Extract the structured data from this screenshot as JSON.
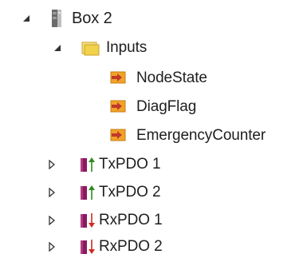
{
  "tree": {
    "box": {
      "label": "Box 2",
      "expanded": true,
      "icon": "device-icon"
    },
    "inputs": {
      "label": "Inputs",
      "expanded": true,
      "icon": "folder-icon",
      "folder_color": "#f2d14b"
    },
    "variables": [
      {
        "label": "NodeState",
        "icon": "input-variable-icon"
      },
      {
        "label": "DiagFlag",
        "icon": "input-variable-icon"
      },
      {
        "label": "EmergencyCounter",
        "icon": "input-variable-icon"
      }
    ],
    "pdos": [
      {
        "label": "TxPDO 1",
        "expanded": false,
        "icon": "tx-pdo-icon",
        "arrow_color": "#2e8b1f"
      },
      {
        "label": "TxPDO 2",
        "expanded": false,
        "icon": "tx-pdo-icon",
        "arrow_color": "#2e8b1f"
      },
      {
        "label": "RxPDO 1",
        "expanded": false,
        "icon": "rx-pdo-icon",
        "arrow_color": "#d42a1c"
      },
      {
        "label": "RxPDO 2",
        "expanded": false,
        "icon": "rx-pdo-icon",
        "arrow_color": "#d42a1c"
      }
    ],
    "colors": {
      "pdo_block": "#8a1a5c",
      "variable_body": "#f0a229",
      "variable_arrow": "#c0392b"
    }
  }
}
